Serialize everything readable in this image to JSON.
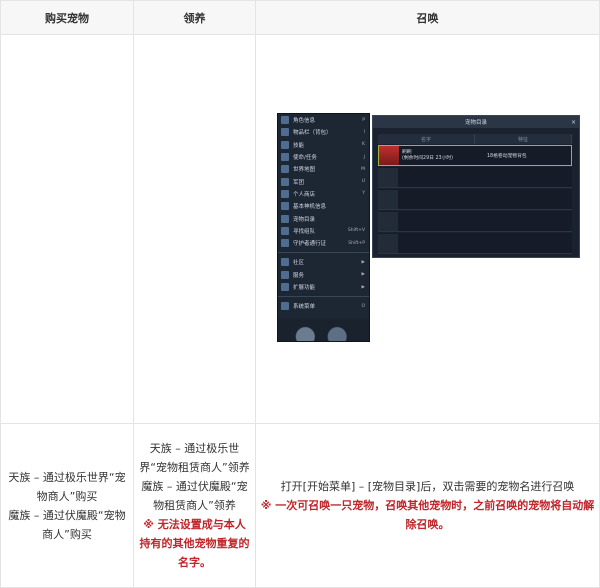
{
  "headers": [
    "购买宠物",
    "领养",
    "召唤"
  ],
  "buy": {
    "lines": [
      "天族 – 通过极乐世界“宠物商人”购买",
      "魔族 – 通过伏魔殿“宠物商人”购买"
    ]
  },
  "adopt": {
    "lines": [
      "天族 – 通过极乐世界“宠物租赁商人”领养",
      "魔族 – 通过伏魔殿“宠物租赁商人”领养"
    ],
    "note": "※ 无法设置成与本人持有的其他宠物重复的名字。"
  },
  "summon": {
    "line": "打开[开始菜单] – [宠物目录]后，双击需要的宠物名进行召唤",
    "note": "※ 一次可召唤一只宠物，召唤其他宠物时，之前召唤的宠物将自动解除召唤。"
  },
  "game": {
    "menu": [
      {
        "label": "角色信息",
        "key": "P"
      },
      {
        "label": "物品栏（背包）",
        "key": "I"
      },
      {
        "label": "技能",
        "key": "K"
      },
      {
        "label": "使命/任务",
        "key": "J"
      },
      {
        "label": "世界地图",
        "key": "M"
      },
      {
        "label": "军团",
        "key": "U"
      },
      {
        "label": "个人商店",
        "key": "Y"
      },
      {
        "label": "基本神机信息",
        "key": ""
      },
      {
        "label": "宠物目录",
        "key": ""
      },
      {
        "label": "寻找组队",
        "key": "Shift+V"
      },
      {
        "label": "守护者通行证",
        "key": "Shift+P"
      }
    ],
    "menu2": [
      {
        "label": "社区",
        "key": "▶"
      },
      {
        "label": "服务",
        "key": "▶"
      },
      {
        "label": "扩展功能",
        "key": "▶"
      }
    ],
    "system": {
      "label": "系统菜单",
      "key": "O"
    },
    "window": {
      "title": "宠物目录",
      "close": "×",
      "col_name": "名字",
      "col_feature": "特征",
      "pet_name": "刷刷",
      "pet_time": "(剩余时间29日 23小时)",
      "pet_feature": "18格卷动宠物背包"
    }
  }
}
